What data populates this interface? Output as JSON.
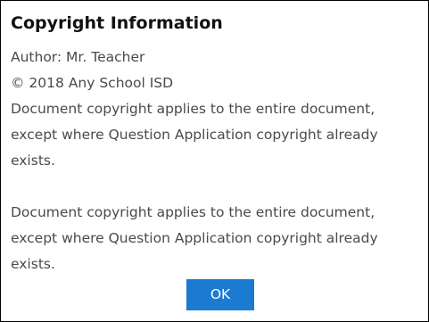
{
  "dialog": {
    "title": "Copyright Information",
    "author_line": "Author: Mr. Teacher",
    "copyright_line": "© 2018 Any School ISD",
    "paragraph1": [
      "Document copyright applies to the entire document,",
      "except where Question Application copyright already",
      "exists."
    ],
    "paragraph2": [
      "Document copyright applies to the entire document,",
      "except where Question Application copyright already",
      "exists."
    ],
    "ok_label": "OK"
  },
  "colors": {
    "button_background": "#1a7bd1",
    "button_text": "#ffffff",
    "body_text": "#4a4a4a",
    "border": "#000000"
  }
}
